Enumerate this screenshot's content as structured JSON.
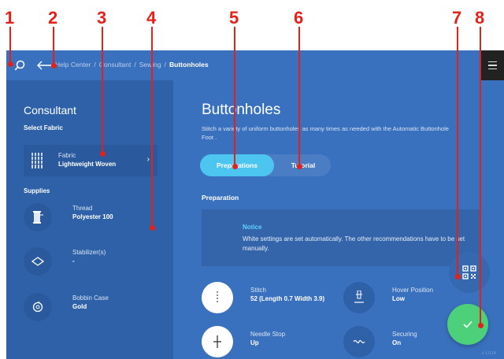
{
  "callouts": [
    "1",
    "2",
    "3",
    "4",
    "5",
    "6",
    "7",
    "8"
  ],
  "colors": {
    "callout": "#e32119",
    "background": "#3a71bf",
    "sidebar": "#2f61a8",
    "accent": "#4cc5f0",
    "confirm": "#4cd07a"
  },
  "breadcrumb": {
    "items": [
      "Help Center",
      "Consultant",
      "Sewing"
    ],
    "current": "Buttonholes",
    "separator": "/"
  },
  "sidebar": {
    "title": "Consultant",
    "select_fabric_label": "Select Fabric",
    "fabric": {
      "name": "Fabric",
      "value": "Lightweight Woven",
      "icon": "fabric-icon"
    },
    "supplies_label": "Supplies",
    "supplies": [
      {
        "name": "Thread",
        "value": "Polyester 100",
        "icon": "thread-icon"
      },
      {
        "name": "Stabilizer(s)",
        "value": "-",
        "icon": "stabilizer-icon"
      },
      {
        "name": "Bobbin Case",
        "value": "Gold",
        "icon": "bobbin-case-icon"
      }
    ]
  },
  "main": {
    "title": "Buttonholes",
    "description": "Stitch a variety of uniform buttonholes as many times as needed with the Automatic Buttonhole Foot .",
    "tabs": [
      "Preparations",
      "Tutorial"
    ],
    "section_heading": "Preparation",
    "notice": {
      "title": "Notice",
      "text": "White settings are set automatically. The other recommendations have to be set manually."
    },
    "settings": [
      {
        "name": "Stitch",
        "value": "52 (Length 0.7 Width 3.9)",
        "icon": "stitch-icon"
      },
      {
        "name": "Hover Position",
        "value": "Low",
        "icon": "hover-position-icon"
      },
      {
        "name": "Needle Stop",
        "value": "Up",
        "icon": "needle-stop-icon"
      },
      {
        "name": "Securing",
        "value": "On",
        "icon": "securing-icon"
      }
    ]
  },
  "version": "v 1.0.14"
}
